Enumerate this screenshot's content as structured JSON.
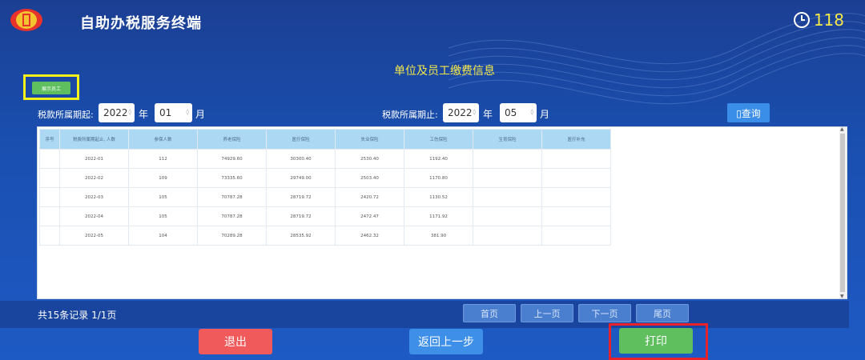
{
  "app": {
    "title": "自助办税服务终端",
    "timer": "118"
  },
  "page_title": "单位及员工缴费信息",
  "employee_button": "展示员工",
  "filters": {
    "start_label": "税款所属期起:",
    "start_year": "2022",
    "start_month": "01",
    "end_label": "税款所属期止:",
    "end_year": "2022",
    "end_month": "05",
    "year_unit": "年",
    "month_unit": "月",
    "query_button": "查询"
  },
  "table": {
    "headers": [
      "序号",
      "税费所属期起止, 人数",
      "参保人数",
      "养老保险",
      "医疗保险",
      "失业保险",
      "工伤保险",
      "生育保险",
      "医疗补充"
    ],
    "rows": [
      [
        "",
        "2022-01",
        "112",
        "74929.60",
        "30300.40",
        "2530.40",
        "1192.40",
        "",
        ""
      ],
      [
        "",
        "2022-02",
        "109",
        "73335.60",
        "29749.00",
        "2503.40",
        "1170.80",
        "",
        ""
      ],
      [
        "",
        "2022-03",
        "105",
        "70787.28",
        "28719.72",
        "2420.72",
        "1130.52",
        "",
        ""
      ],
      [
        "",
        "2022-04",
        "105",
        "70787.28",
        "28719.72",
        "2472.47",
        "1171.92",
        "",
        ""
      ],
      [
        "",
        "2022-05",
        "104",
        "70289.28",
        "28535.92",
        "2462.32",
        "381.90",
        "",
        ""
      ]
    ]
  },
  "pagination": {
    "records": "共15条记录  1/1页",
    "first": "首页",
    "prev": "上一页",
    "next": "下一页",
    "last": "尾页"
  },
  "actions": {
    "exit": "退出",
    "back": "返回上一步",
    "print": "打印"
  },
  "colors": {
    "title_yellow": "#f4e84a",
    "highlight_yellow": "#f4f01a",
    "highlight_red": "#e8222c",
    "green": "#5fbf5f",
    "red": "#f05a5a",
    "blue": "#3d8fe8"
  }
}
